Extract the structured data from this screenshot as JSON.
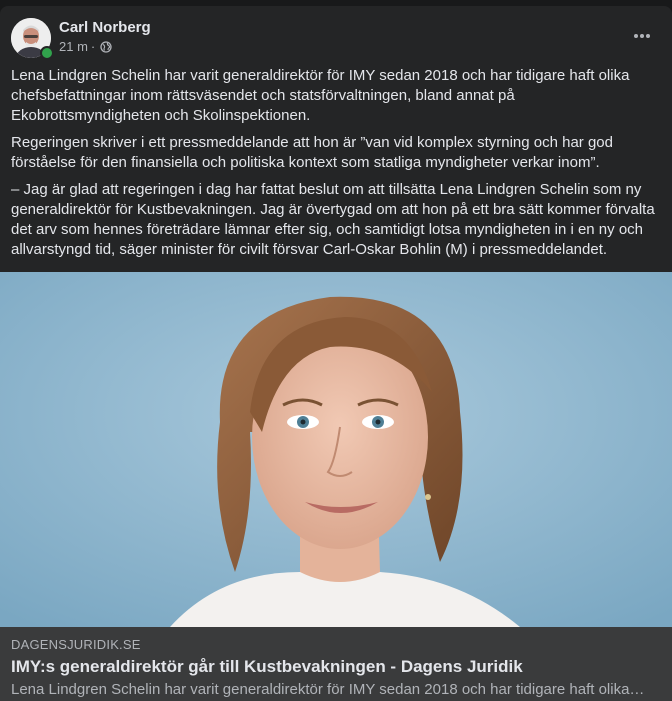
{
  "post": {
    "author": "Carl Norberg",
    "time": "21 m",
    "separator": "·",
    "privacy_icon": "globe-icon",
    "more_icon": "more-icon",
    "paragraphs": [
      "Lena Lindgren Schelin har varit generaldirektör för IMY sedan 2018 och har tidigare haft olika chefsbefattningar inom rättsväsendet och statsförvaltningen, bland annat på Ekobrottsmyndigheten och Skolinspektionen.",
      "Regeringen skriver i ett pressmeddelande att hon är ”van vid komplex styrning och har god förståelse för den finansiella och politiska kontext som statliga myndigheter verkar inom”.",
      "– Jag är glad att regeringen i dag har fattat beslut om att tillsätta Lena Lindgren Schelin som ny generaldirektör för Kustbevakningen. Jag är övertygad om att hon på ett bra sätt kommer förvalta det arv som hennes företrädare lämnar efter sig, och samtidigt lotsa myndigheten in i en ny och allvarstyngd tid, säger minister för civilt försvar Carl-Oskar Bohlin (M) i pressmeddelandet."
    ]
  },
  "link": {
    "domain": "DAGENSJURIDIK.SE",
    "title": "IMY:s generaldirektör går till Kustbevakningen - Dagens Juridik",
    "description": "Lena Lindgren Schelin har varit generaldirektör för IMY sedan 2018 och har tidigare haft olika…"
  },
  "colors": {
    "card_bg": "#242526",
    "page_bg": "#18191a",
    "text_primary": "#e4e6eb",
    "text_secondary": "#b0b3b8",
    "link_box_bg": "#3a3b3c",
    "online": "#31a24c",
    "photo_bg": "#8ab4cc"
  }
}
